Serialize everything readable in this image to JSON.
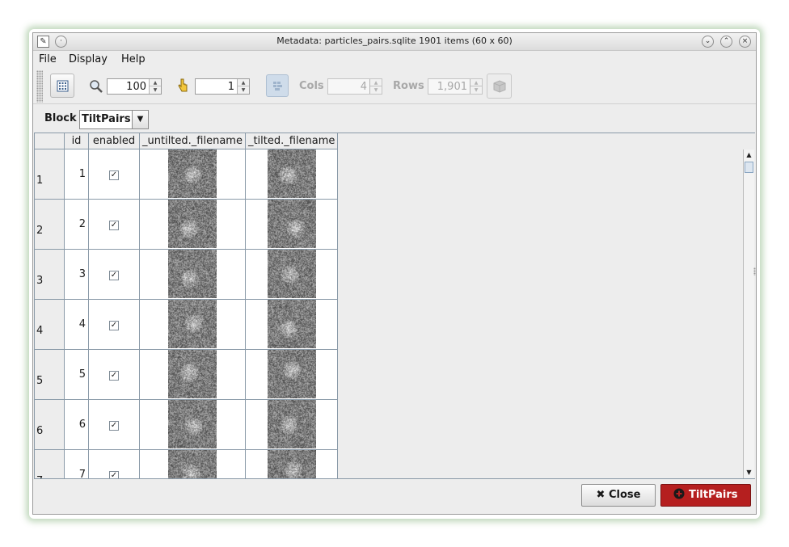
{
  "window": {
    "title": "Metadata: particles_pairs.sqlite 1901 items (60 x 60)",
    "app_icon": "xmipp-app-icon"
  },
  "menu": [
    "File",
    "Display",
    "Help"
  ],
  "toolbar": {
    "zoom_value": "100",
    "goto_value": "1",
    "cols_label": "Cols",
    "cols_value": "4",
    "rows_label": "Rows",
    "rows_value": "1,901"
  },
  "block": {
    "label": "Block",
    "selected": "TiltPairs"
  },
  "table": {
    "columns": [
      "id",
      "enabled",
      "_untilted._filename",
      "_tilted._filename"
    ],
    "rows": [
      {
        "row": "1",
        "id": "1",
        "enabled": true
      },
      {
        "row": "2",
        "id": "2",
        "enabled": true
      },
      {
        "row": "3",
        "id": "3",
        "enabled": true
      },
      {
        "row": "4",
        "id": "4",
        "enabled": true
      },
      {
        "row": "5",
        "id": "5",
        "enabled": true
      },
      {
        "row": "6",
        "id": "6",
        "enabled": true
      },
      {
        "row": "7",
        "id": "7",
        "enabled": true
      }
    ]
  },
  "buttons": {
    "close": "Close",
    "tiltpairs": "TiltPairs"
  },
  "colors": {
    "accent_red": "#b51f1f",
    "window_bg": "#ededed",
    "grid_line": "#8a9aa8"
  }
}
